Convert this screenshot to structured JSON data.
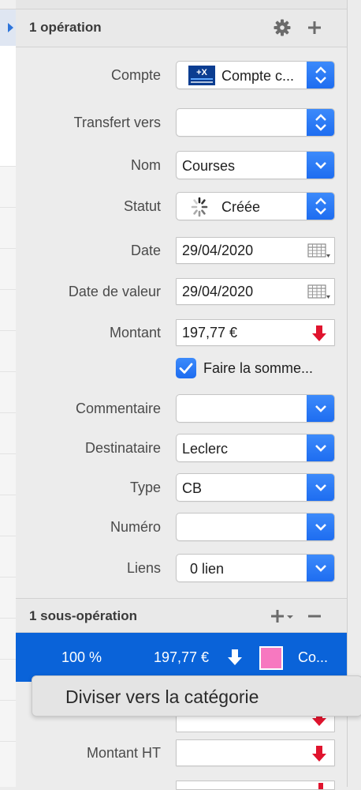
{
  "colors": {
    "accent": "#1d6cf0",
    "selection": "#0a63d9",
    "arrow_red": "#e0142e",
    "swatch": "#f778c0"
  },
  "operation": {
    "title": "1 opération",
    "gear_icon": "gear-icon",
    "add_icon": "plus-icon",
    "fields": {
      "compte": {
        "label": "Compte",
        "value": "Compte c..."
      },
      "transfert": {
        "label": "Transfert vers",
        "value": ""
      },
      "nom": {
        "label": "Nom",
        "value": "Courses"
      },
      "statut": {
        "label": "Statut",
        "value": "Créée"
      },
      "date": {
        "label": "Date",
        "value": "29/04/2020"
      },
      "date_valeur": {
        "label": "Date de valeur",
        "value": "29/04/2020"
      },
      "montant": {
        "label": "Montant",
        "value": "197,77 €"
      },
      "faire_somme": {
        "label": "Faire la somme...",
        "checked": true
      },
      "commentaire": {
        "label": "Commentaire",
        "value": ""
      },
      "destinataire": {
        "label": "Destinataire",
        "value": "Leclerc"
      },
      "type": {
        "label": "Type",
        "value": "CB"
      },
      "numero": {
        "label": "Numéro",
        "value": ""
      },
      "liens": {
        "label": "Liens",
        "value": "0 lien"
      }
    }
  },
  "sous_operation": {
    "title": "1 sous-opération",
    "row": {
      "percent": "100 %",
      "amount": "197,77 €",
      "category": "Co..."
    },
    "montant_ht": {
      "label": "Montant HT",
      "value": ""
    }
  },
  "tooltip": {
    "text": "Diviser vers la catégorie"
  }
}
